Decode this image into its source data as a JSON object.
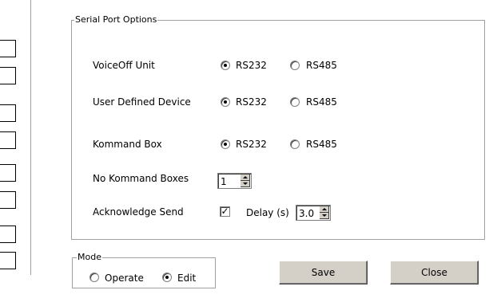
{
  "serial_port_options": {
    "title": "Serial Port Options",
    "rows": [
      {
        "label": "VoiceOff Unit",
        "option1": "RS232",
        "option2": "RS485",
        "selected": "RS232"
      },
      {
        "label": "User Defined Device",
        "option1": "RS232",
        "option2": "RS485",
        "selected": "RS232"
      },
      {
        "label": "Kommand Box",
        "option1": "RS232",
        "option2": "RS485",
        "selected": "RS232"
      }
    ],
    "no_kommand_boxes": {
      "label": "No Kommand Boxes",
      "value": "1"
    },
    "acknowledge_send": {
      "label": "Acknowledge Send",
      "checked": true
    },
    "delay": {
      "label": "Delay (s)",
      "value": "3.0"
    }
  },
  "mode": {
    "title": "Mode",
    "options": [
      {
        "label": "Operate",
        "selected": false
      },
      {
        "label": "Edit",
        "selected": true
      }
    ]
  },
  "buttons": {
    "save": "Save",
    "close": "Close"
  }
}
